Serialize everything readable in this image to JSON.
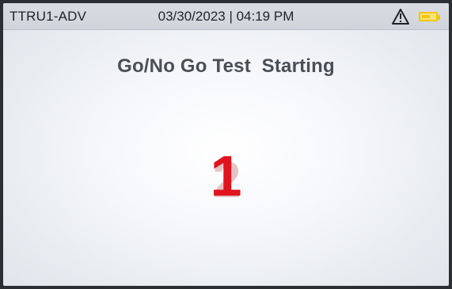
{
  "status_bar": {
    "device_id": "TTRU1-ADV",
    "datetime": "03/30/2023 | 04:19 PM",
    "icons": [
      "warning-icon",
      "battery-icon"
    ],
    "battery_color": "#f2c600"
  },
  "main": {
    "title": "Go/No Go Test  Starting",
    "countdown": {
      "current": "1",
      "next": "2",
      "current_color": "#e0141f",
      "next_color": "#e2b0b3"
    }
  }
}
